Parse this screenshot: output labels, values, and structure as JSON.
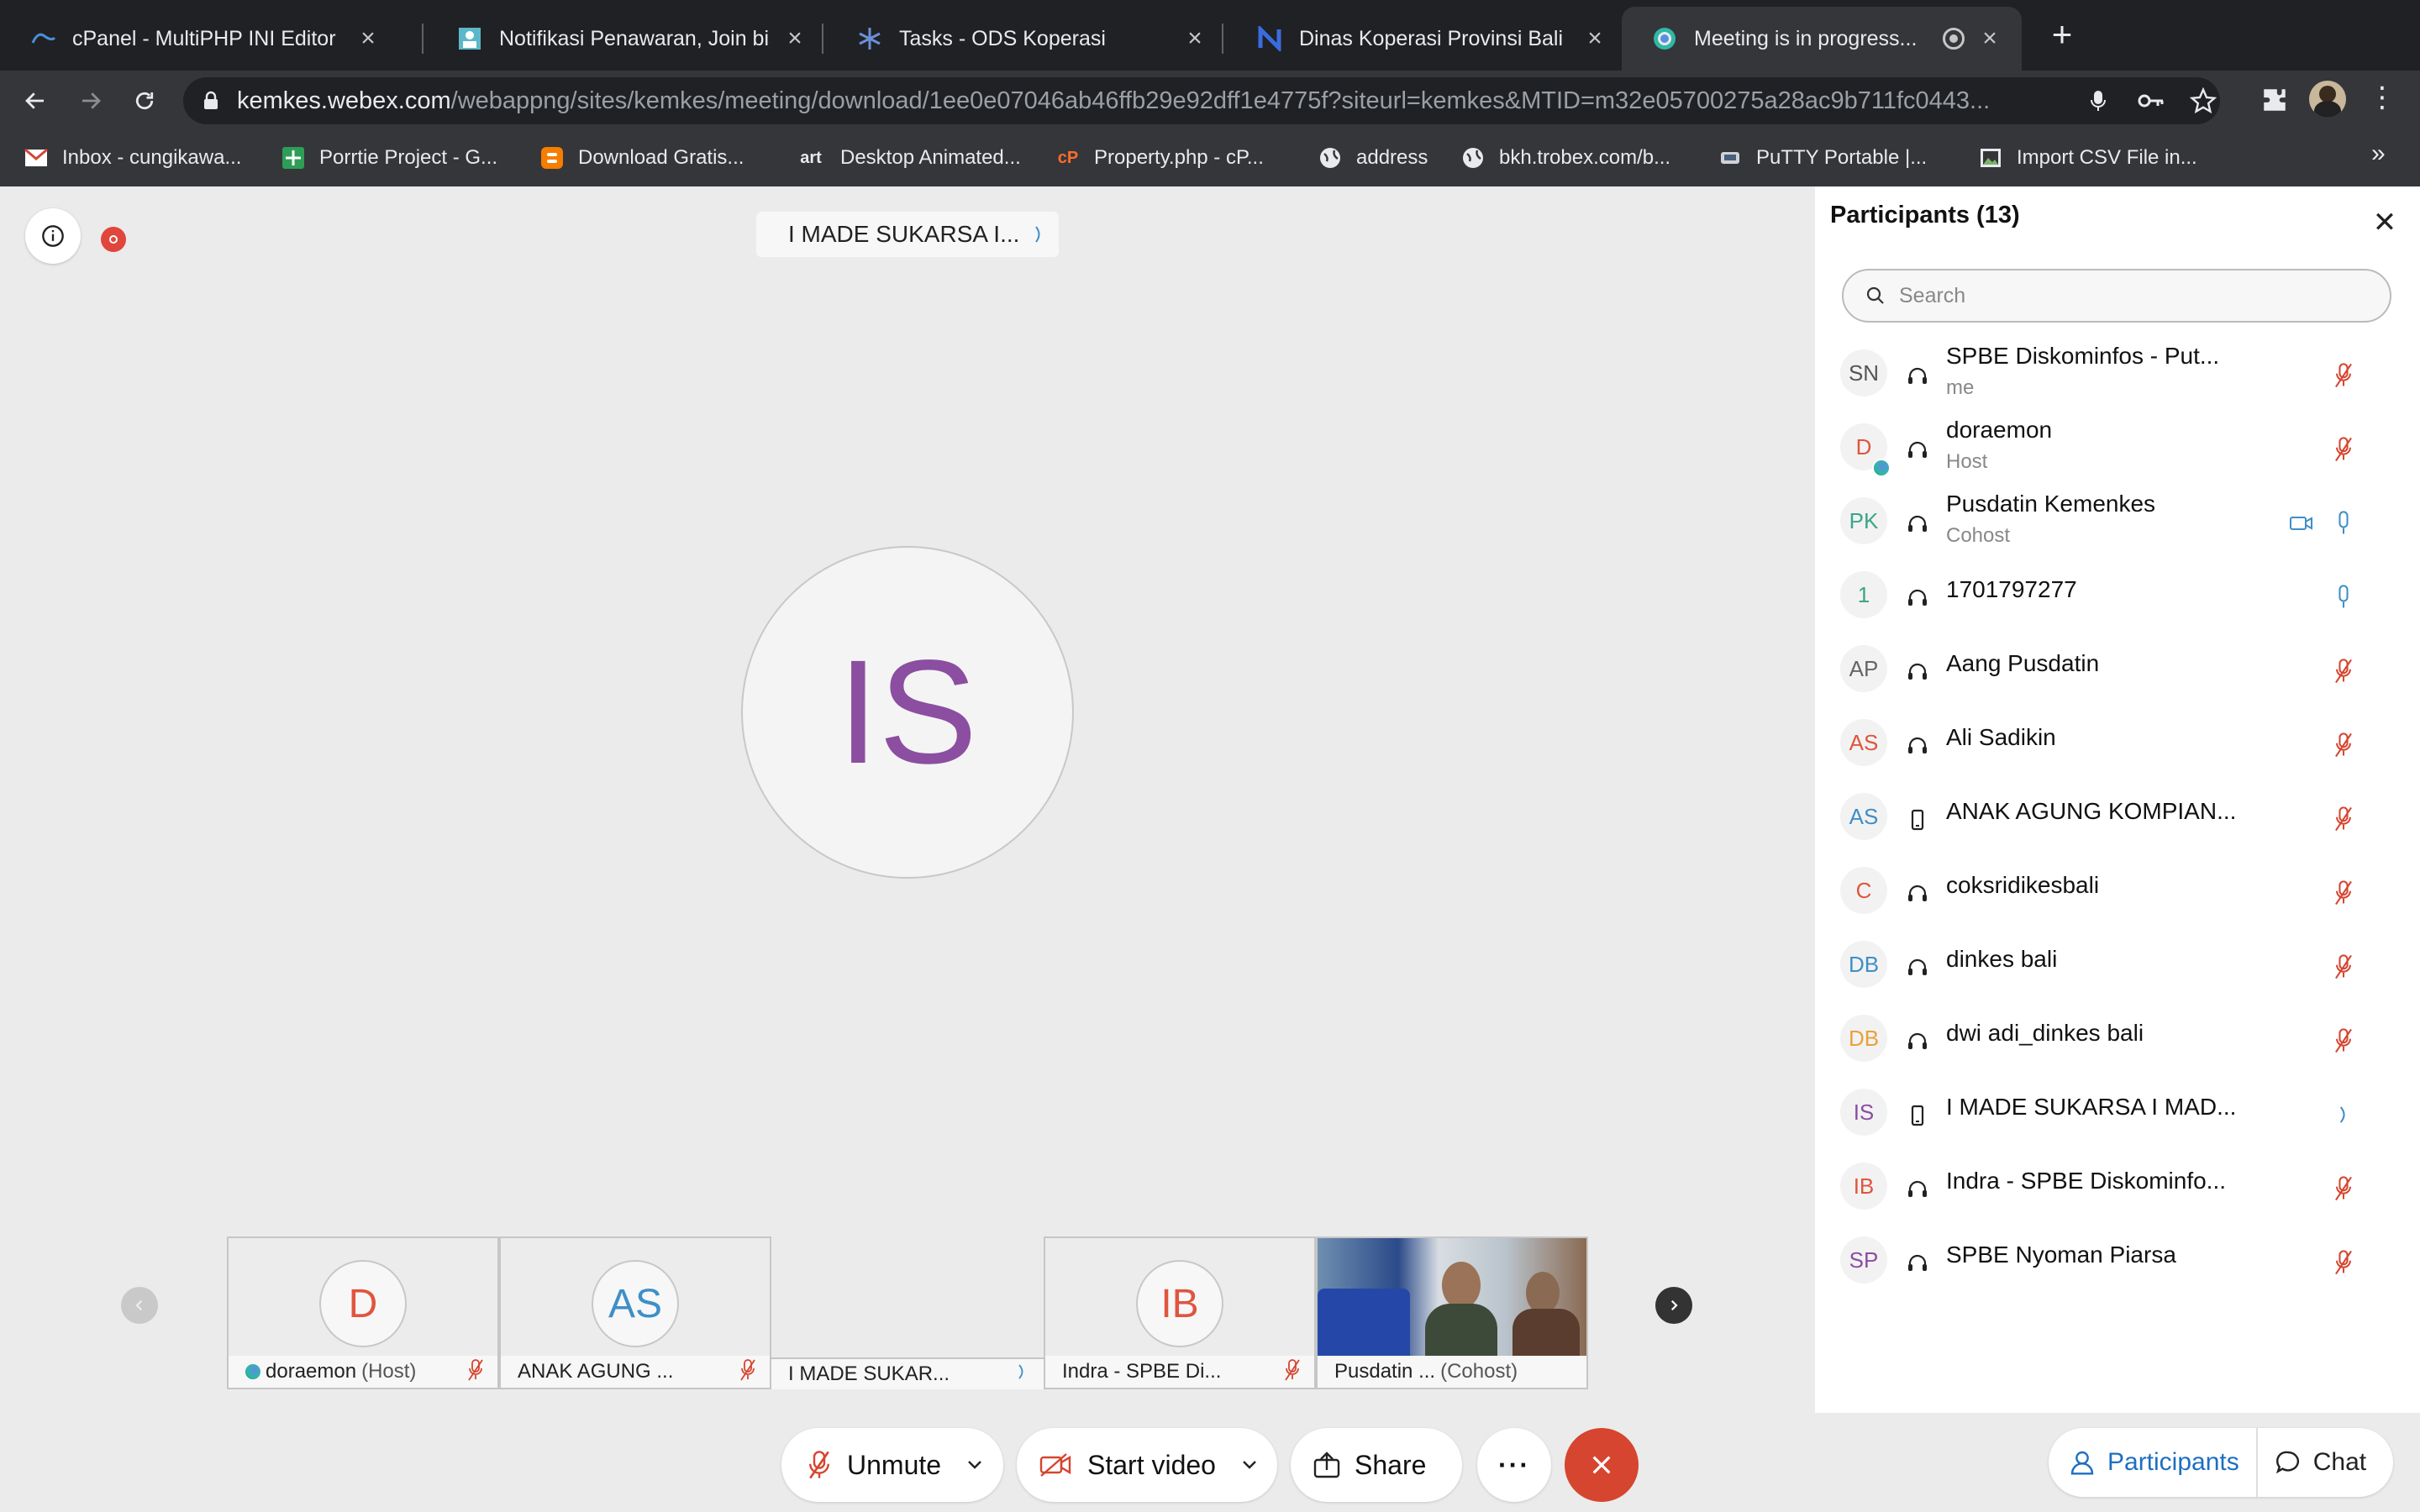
{
  "browser": {
    "tabs": [
      {
        "title": "cPanel - MultiPHP INI Editor",
        "icon": "cpanel-icon"
      },
      {
        "title": "Notifikasi Penawaran, Join bisnis",
        "icon": "people-icon"
      },
      {
        "title": "Tasks - ODS Koperasi",
        "icon": "asterisk-icon"
      },
      {
        "title": "Dinas Koperasi Provinsi Bali",
        "icon": "n-logo-icon"
      },
      {
        "title": "Meeting is in progress...",
        "icon": "webex-icon",
        "active": true
      }
    ],
    "url_host": "kemkes.webex.com",
    "url_rest": "/webappng/sites/kemkes/meeting/download/1ee0e07046ab46ffb29e92dff1e4775f?siteurl=kemkes&MTID=m32e05700275a28ac9b711fc0443...",
    "bookmarks": [
      {
        "label": "Inbox - cungikawa...",
        "icon": "gmail-icon"
      },
      {
        "label": "Porrtie Project - G...",
        "icon": "plus-icon"
      },
      {
        "label": "Download Gratis...",
        "icon": "blogger-icon"
      },
      {
        "label": "Desktop Animated...",
        "icon": "art-icon",
        "glyph": "art"
      },
      {
        "label": "Property.php - cP...",
        "icon": "cpanel-icon",
        "glyph": "cP"
      },
      {
        "label": "address",
        "icon": "globe-icon"
      },
      {
        "label": "bkh.trobex.com/b...",
        "icon": "globe-icon"
      },
      {
        "label": "PuTTY Portable |...",
        "icon": "putty-icon"
      },
      {
        "label": "Import CSV File in...",
        "icon": "image-icon"
      }
    ],
    "more_bookmarks": "»"
  },
  "meeting": {
    "active_speaker": "I MADE SUKARSA I...",
    "active_initials": "IS",
    "filmstrip": [
      {
        "initials": "D",
        "name": "doraemon",
        "role": "(Host)",
        "muted": true,
        "color": "#e0553f",
        "host_badge": true
      },
      {
        "initials": "AS",
        "name": "ANAK AGUNG ...",
        "role": "",
        "muted": true,
        "color": "#3e8fc7"
      },
      {
        "initials": "",
        "name": "I MADE SUKAR...",
        "role": "",
        "muted": false,
        "color": "#8b4ea0",
        "blank": true
      },
      {
        "initials": "IB",
        "name": "Indra - SPBE Di...",
        "role": "",
        "muted": true,
        "color": "#e0553f"
      },
      {
        "initials": "",
        "name": "Pusdatin ...",
        "role": "(Cohost)",
        "muted": false,
        "video": true
      }
    ],
    "controls": {
      "unmute": "Unmute",
      "start_video": "Start video",
      "share": "Share",
      "more": "···",
      "participants": "Participants",
      "chat": "Chat"
    }
  },
  "participants_panel": {
    "title": "Participants (13)",
    "search_placeholder": "Search",
    "list": [
      {
        "initials": "SN",
        "name": "SPBE Diskominfos - Put...",
        "role": "me",
        "device": "headset",
        "mic": "muted",
        "color": "#555555"
      },
      {
        "initials": "D",
        "name": "doraemon",
        "role": "Host",
        "device": "headset",
        "mic": "muted",
        "color": "#e0553f",
        "badge": true
      },
      {
        "initials": "PK",
        "name": "Pusdatin Kemenkes",
        "role": "Cohost",
        "device": "headset",
        "mic": "on",
        "video": true,
        "color": "#3aa687"
      },
      {
        "initials": "1",
        "name": "1701797277",
        "role": "",
        "device": "headset",
        "mic": "on",
        "color": "#3aa687"
      },
      {
        "initials": "AP",
        "name": "Aang Pusdatin",
        "role": "",
        "device": "headset",
        "mic": "muted",
        "color": "#666666"
      },
      {
        "initials": "AS",
        "name": "Ali Sadikin",
        "role": "",
        "device": "headset",
        "mic": "muted",
        "color": "#e0553f"
      },
      {
        "initials": "AS",
        "name": "ANAK AGUNG KOMPIAN...",
        "role": "",
        "device": "phone",
        "mic": "muted",
        "color": "#3e8fc7"
      },
      {
        "initials": "C",
        "name": "coksridikesbali",
        "role": "",
        "device": "headset",
        "mic": "muted",
        "color": "#e0553f"
      },
      {
        "initials": "DB",
        "name": "dinkes bali",
        "role": "",
        "device": "headset",
        "mic": "muted",
        "color": "#3e8fc7"
      },
      {
        "initials": "DB",
        "name": "dwi adi_dinkes bali",
        "role": "",
        "device": "headset",
        "mic": "muted",
        "color": "#e8a23a"
      },
      {
        "initials": "IS",
        "name": "I MADE SUKARSA I MAD...",
        "role": "",
        "device": "phone",
        "mic": "speaking",
        "color": "#8b4ea0"
      },
      {
        "initials": "IB",
        "name": "Indra - SPBE Diskominfo...",
        "role": "",
        "device": "headset",
        "mic": "muted",
        "color": "#e0553f"
      },
      {
        "initials": "SP",
        "name": "SPBE Nyoman Piarsa",
        "role": "",
        "device": "headset",
        "mic": "muted",
        "color": "#8b4ea0"
      }
    ]
  },
  "colors": {
    "mute_red": "#d6452f",
    "accent_blue": "#3e8fc7",
    "end_call": "#d6452f"
  }
}
